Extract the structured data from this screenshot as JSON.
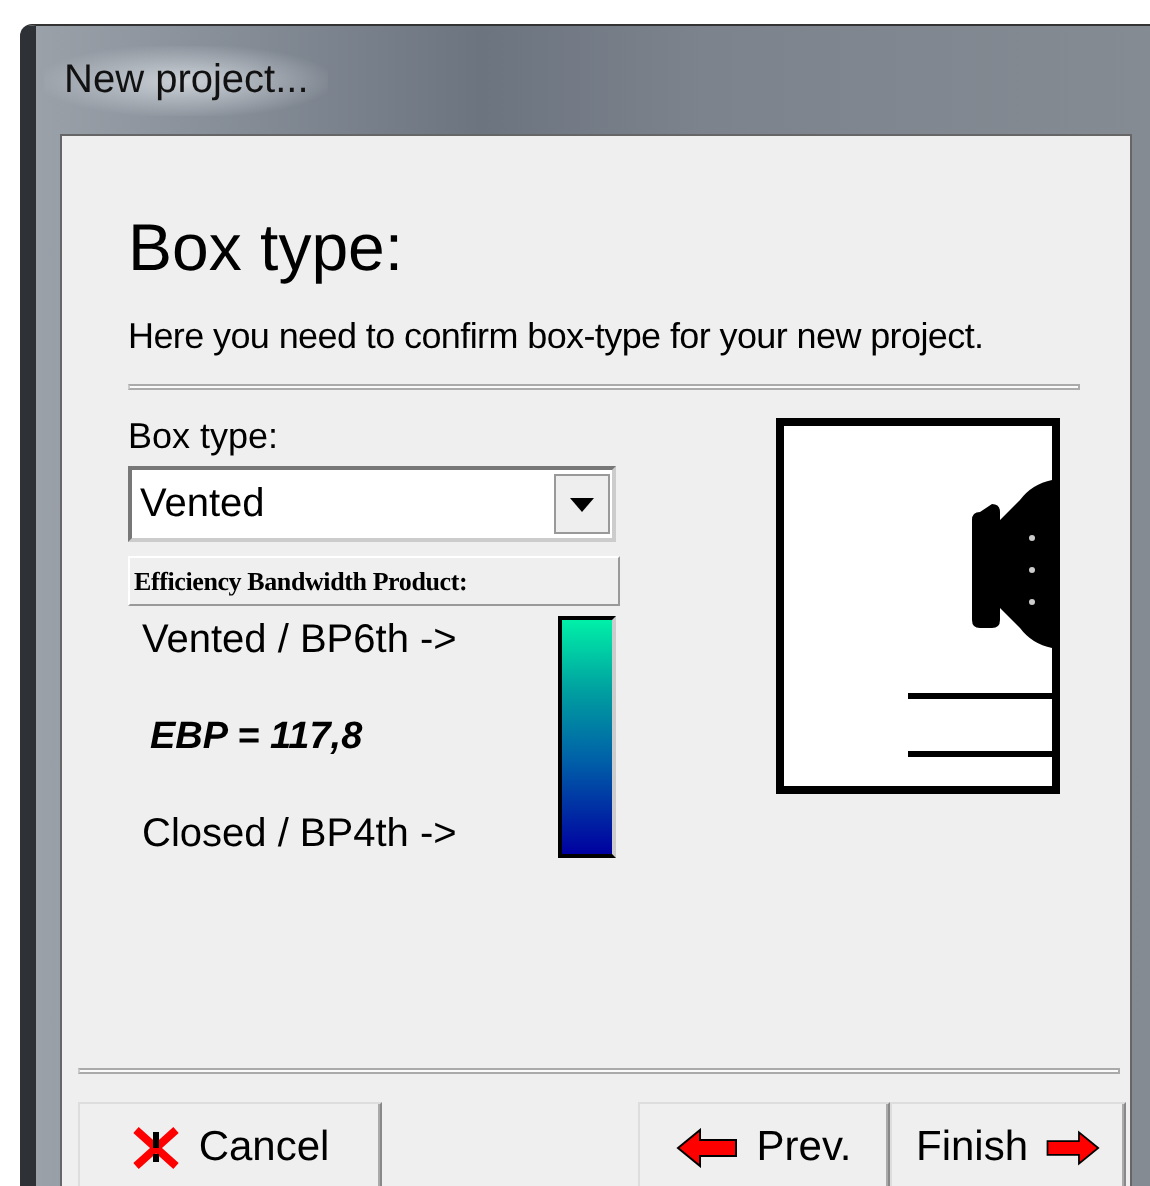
{
  "window": {
    "title": "New project..."
  },
  "heading": "Box type:",
  "description": "Here you need to confirm box-type for your new project.",
  "box_type": {
    "label": "Box type:",
    "value": "Vented"
  },
  "ebp": {
    "header": "Efficiency Bandwidth Product:",
    "top_label": "Vented / BP6th ->",
    "value": "EBP = 117,8",
    "bottom_label": "Closed / BP4th ->"
  },
  "buttons": [
    {
      "label": "Cancel",
      "kind": "cancel"
    },
    {
      "label": "Prev.",
      "kind": "back"
    },
    {
      "label": "Finish",
      "kind": "next"
    }
  ]
}
